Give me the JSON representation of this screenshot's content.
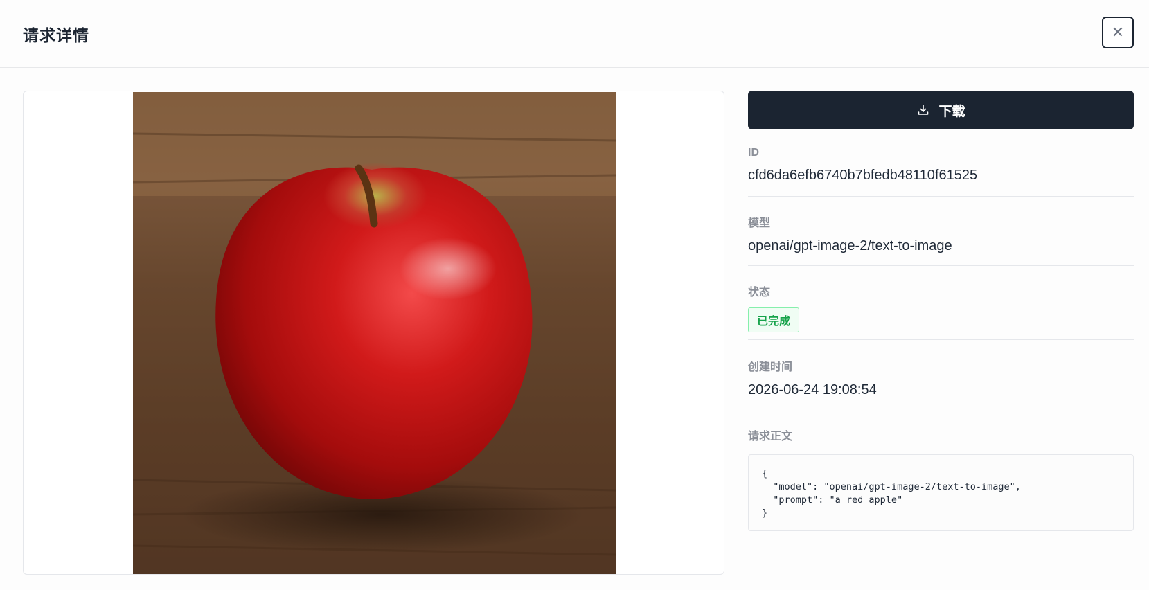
{
  "header": {
    "title": "请求详情",
    "close_icon": "close-icon"
  },
  "actions": {
    "download_label": "下载",
    "download_icon": "download-icon"
  },
  "fields": {
    "id": {
      "label": "ID",
      "value": "cfd6da6efb6740b7bfedb48110f61525"
    },
    "model": {
      "label": "模型",
      "value": "openai/gpt-image-2/text-to-image"
    },
    "status": {
      "label": "状态",
      "value": "已完成",
      "color": "#16a34a"
    },
    "created_at": {
      "label": "创建时间",
      "value": "2026-06-24 19:08:54"
    },
    "request_body": {
      "label": "请求正文",
      "value": "{\n  \"model\": \"openai/gpt-image-2/text-to-image\",\n  \"prompt\": \"a red apple\"\n}"
    }
  },
  "colors": {
    "primary": "#1b2431",
    "success": "#16a34a"
  }
}
